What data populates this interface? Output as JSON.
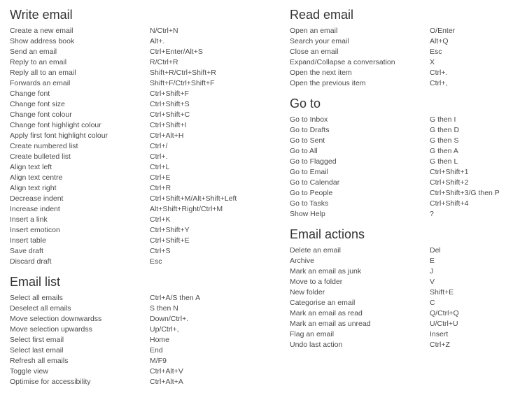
{
  "left_column": {
    "write_email": {
      "title": "Write email",
      "rows": [
        {
          "action": "Create a new email",
          "keys": "N/Ctrl+N"
        },
        {
          "action": "Show address book",
          "keys": "Alt+."
        },
        {
          "action": "Send an email",
          "keys": "Ctrl+Enter/Alt+S"
        },
        {
          "action": "Reply to an email",
          "keys": "R/Ctrl+R"
        },
        {
          "action": "Reply all to an email",
          "keys": "Shift+R/Ctrl+Shift+R"
        },
        {
          "action": "Forwards an email",
          "keys": "Shift+F/Ctrl+Shift+F"
        },
        {
          "action": "Change font",
          "keys": "Ctrl+Shift+F"
        },
        {
          "action": "Change font size",
          "keys": "Ctrl+Shift+S"
        },
        {
          "action": "Change font colour",
          "keys": "Ctrl+Shift+C"
        },
        {
          "action": "Change font highlight colour",
          "keys": "Ctrl+Shift+I"
        },
        {
          "action": "Apply first font highlight colour",
          "keys": "Ctrl+Alt+H"
        },
        {
          "action": "Create numbered list",
          "keys": "Ctrl+/"
        },
        {
          "action": "Create bulleted list",
          "keys": "Ctrl+."
        },
        {
          "action": "Align text left",
          "keys": "Ctrl+L"
        },
        {
          "action": "Align text centre",
          "keys": "Ctrl+E"
        },
        {
          "action": "Align text right",
          "keys": "Ctrl+R"
        },
        {
          "action": "Decrease indent",
          "keys": "Ctrl+Shift+M/Alt+Shift+Left"
        },
        {
          "action": "Increase indent",
          "keys": "Alt+Shift+Right/Ctrl+M"
        },
        {
          "action": "Insert a link",
          "keys": "Ctrl+K"
        },
        {
          "action": "Insert emoticon",
          "keys": "Ctrl+Shift+Y"
        },
        {
          "action": "Insert table",
          "keys": "Ctrl+Shift+E"
        },
        {
          "action": "Save draft",
          "keys": "Ctrl+S"
        },
        {
          "action": "Discard draft",
          "keys": "Esc"
        }
      ]
    },
    "email_list": {
      "title": "Email list",
      "rows": [
        {
          "action": "Select all emails",
          "keys": "Ctrl+A/S then A"
        },
        {
          "action": "Deselect all emails",
          "keys": "S then N"
        },
        {
          "action": "Move selection downwardss",
          "keys": "Down/Ctrl+."
        },
        {
          "action": "Move selection upwardss",
          "keys": "Up/Ctrl+,"
        },
        {
          "action": "Select first email",
          "keys": "Home"
        },
        {
          "action": "Select last email",
          "keys": "End"
        },
        {
          "action": "Refresh all emails",
          "keys": "M/F9"
        },
        {
          "action": "Toggle view",
          "keys": "Ctrl+Alt+V"
        },
        {
          "action": "Optimise for accessibility",
          "keys": "Ctrl+Alt+A"
        }
      ]
    }
  },
  "right_column": {
    "read_email": {
      "title": "Read email",
      "rows": [
        {
          "action": "Open an email",
          "keys": "O/Enter"
        },
        {
          "action": "Search your email",
          "keys": "Alt+Q"
        },
        {
          "action": "Close an email",
          "keys": "Esc"
        },
        {
          "action": "Expand/Collapse a conversation",
          "keys": "X"
        },
        {
          "action": "Open the next item",
          "keys": "Ctrl+."
        },
        {
          "action": "Open the previous item",
          "keys": "Ctrl+,"
        }
      ]
    },
    "go_to": {
      "title": "Go to",
      "rows": [
        {
          "action": "Go to Inbox",
          "keys": "G then I"
        },
        {
          "action": "Go to Drafts",
          "keys": "G then D"
        },
        {
          "action": "Go to Sent",
          "keys": "G then S"
        },
        {
          "action": "Go to All",
          "keys": "G then A"
        },
        {
          "action": "Go to Flagged",
          "keys": "G then L"
        },
        {
          "action": "Go to Email",
          "keys": "Ctrl+Shift+1"
        },
        {
          "action": "Go to Calendar",
          "keys": "Ctrl+Shift+2"
        },
        {
          "action": "Go to People",
          "keys": "Ctrl+Shift+3/G then P"
        },
        {
          "action": "Go to Tasks",
          "keys": "Ctrl+Shift+4"
        },
        {
          "action": "Show Help",
          "keys": "?"
        }
      ]
    },
    "email_actions": {
      "title": "Email actions",
      "rows": [
        {
          "action": "Delete an email",
          "keys": "Del"
        },
        {
          "action": "Archive",
          "keys": "E"
        },
        {
          "action": "Mark an email as junk",
          "keys": "J"
        },
        {
          "action": "Move to a folder",
          "keys": "V"
        },
        {
          "action": "New folder",
          "keys": "Shift+E"
        },
        {
          "action": "Categorise an email",
          "keys": "C"
        },
        {
          "action": "Mark an email as read",
          "keys": "Q/Ctrl+Q"
        },
        {
          "action": "Mark an email as unread",
          "keys": "U/Ctrl+U"
        },
        {
          "action": "Flag an email",
          "keys": "Insert"
        },
        {
          "action": "Undo last action",
          "keys": "Ctrl+Z"
        }
      ]
    }
  }
}
